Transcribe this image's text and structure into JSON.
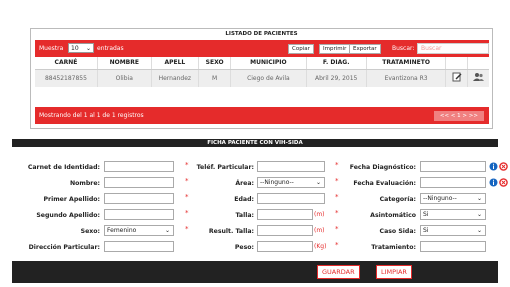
{
  "listado": {
    "title": "LISTADO DE PACIENTES",
    "show_prefix": "Muestra",
    "show_value": "10",
    "show_suffix": "entradas",
    "buttons": [
      "Copiar",
      "Imprimir",
      "Exportar"
    ],
    "search_label": "Buscar:",
    "search_placeholder": "Buscar",
    "columns": [
      "CARNÉ",
      "NOMBRE",
      "APELL",
      "SEXO",
      "MUNICIPIO",
      "F. DIAG.",
      "TRATAMINETO",
      "",
      ""
    ],
    "rows": [
      [
        "88452187855",
        "Olibia",
        "Hernandez",
        "M",
        "Ciego de Avila",
        "Abril 29, 2015",
        "Evantizona R3"
      ]
    ],
    "info": "Mostrando del 1 al 1 de 1 registros",
    "pager": "<< < 1 > >>"
  },
  "ficha": {
    "title": "FICHA PACIENTE CON VIH-SIDA",
    "col1": [
      {
        "label": "Carnet de Identidad:",
        "value": ""
      },
      {
        "label": "Nombre:",
        "value": ""
      },
      {
        "label": "Primer Apellido:",
        "value": ""
      },
      {
        "label": "Segundo Apellido:",
        "value": ""
      },
      {
        "label": "Sexo:",
        "value": "Femenino"
      },
      {
        "label": "Dirección Particular:",
        "value": ""
      }
    ],
    "col2": [
      {
        "label": "Teléf. Particular:",
        "value": "",
        "unit": ""
      },
      {
        "label": "Área:",
        "value": "--Ninguno--",
        "unit": ""
      },
      {
        "label": "Edad:",
        "value": "",
        "unit": ""
      },
      {
        "label": "Talla:",
        "value": "",
        "unit": "(m)"
      },
      {
        "label": "Result. Talla:",
        "value": "",
        "unit": "(m)"
      },
      {
        "label": "Peso:",
        "value": "",
        "unit": "(Kg)"
      }
    ],
    "col3": [
      {
        "label": "Fecha Diagnóstico:",
        "value": ""
      },
      {
        "label": "Fecha Evaluación:",
        "value": ""
      },
      {
        "label": "Categoría:",
        "value": "--Ninguno--"
      },
      {
        "label": "Asintomático",
        "value": "Si"
      },
      {
        "label": "Caso Sida:",
        "value": "Si"
      },
      {
        "label": "Tratamiento:",
        "value": ""
      }
    ],
    "asterisk": "*",
    "save_label": "GUARDAR",
    "clear_label": "LIMPIAR"
  },
  "colors": {
    "accent": "#e52b2b",
    "dark": "#222222",
    "info": "#1565c0"
  }
}
